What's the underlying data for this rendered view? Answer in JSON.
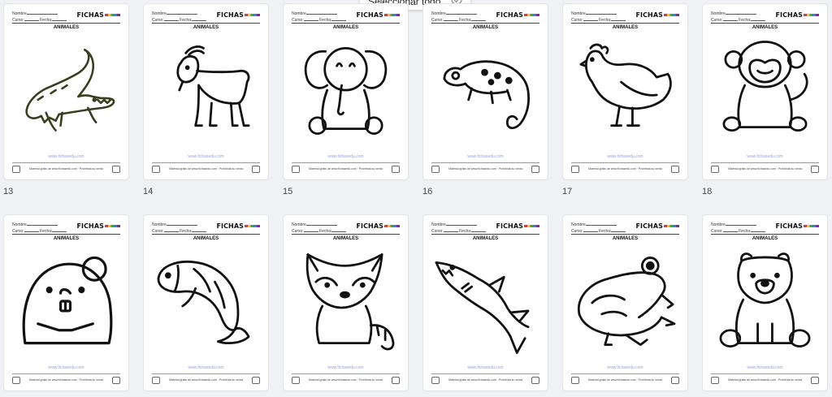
{
  "toolbar": {
    "select_all_label": "Seleccionar todo"
  },
  "sheet": {
    "nombre_label": "Nombre",
    "curso_label": "Curso:",
    "fecha_label": "Fecha:",
    "brand": "FICHAS",
    "title": "ANIMALES",
    "url": "www.fichasedu.com",
    "footer_text": "Material gratis de www.fichasedu.com · Prohibida su venta"
  },
  "pages": [
    {
      "number": "13",
      "animal": "crocodile-drawing"
    },
    {
      "number": "14",
      "animal": "goat-drawing"
    },
    {
      "number": "15",
      "animal": "elephant-drawing"
    },
    {
      "number": "16",
      "animal": "chameleon-drawing"
    },
    {
      "number": "17",
      "animal": "hen-drawing"
    },
    {
      "number": "18",
      "animal": "monkey-drawing"
    },
    {
      "number": "",
      "animal": "beaver-drawing"
    },
    {
      "number": "",
      "animal": "fish-drawing"
    },
    {
      "number": "",
      "animal": "raccoon-drawing"
    },
    {
      "number": "",
      "animal": "shark-drawing"
    },
    {
      "number": "",
      "animal": "frog-drawing"
    },
    {
      "number": "",
      "animal": "bear-drawing"
    }
  ]
}
